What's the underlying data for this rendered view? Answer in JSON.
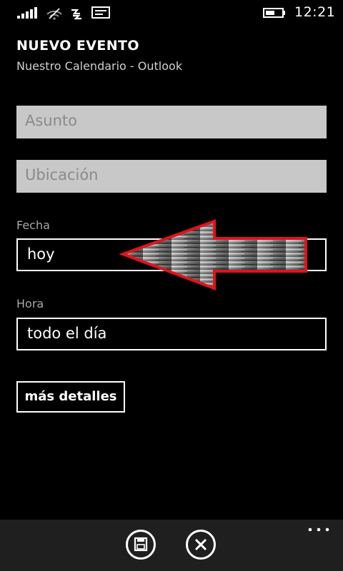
{
  "status_bar": {
    "time": "12:21"
  },
  "header": {
    "title": "NUEVO EVENTO",
    "subtitle": "Nuestro Calendario - Outlook"
  },
  "form": {
    "subject_placeholder": "Asunto",
    "location_placeholder": "Ubicación",
    "date_label": "Fecha",
    "date_value": "hoy",
    "time_label": "Hora",
    "time_value": "todo el día",
    "details_button": "más detalles"
  },
  "app_bar": {
    "icons": [
      "save-icon",
      "close-icon",
      "more-icon"
    ]
  },
  "annotation": {
    "arrow_color": "#e1131a"
  },
  "colors": {
    "background": "#000000",
    "input_gray": "#c8c8c8",
    "app_bar": "#1f1f1f"
  }
}
